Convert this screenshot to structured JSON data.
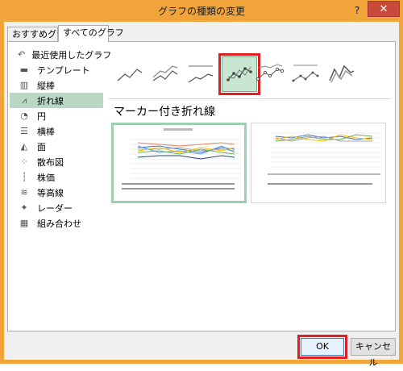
{
  "window": {
    "title": "グラフの種類の変更",
    "help_label": "?",
    "close_label": "✕"
  },
  "tabs": [
    {
      "label": "おすすめグラフ",
      "active": false
    },
    {
      "label": "すべてのグラフ",
      "active": true
    }
  ],
  "sidebar": {
    "items": [
      {
        "label": "最近使用したグラフ",
        "icon": "recent-icon",
        "glyph": "↶"
      },
      {
        "label": "テンプレート",
        "icon": "folder-icon",
        "glyph": "▬"
      },
      {
        "label": "縦棒",
        "icon": "column-chart-icon",
        "glyph": "▥"
      },
      {
        "label": "折れ線",
        "icon": "line-chart-icon",
        "glyph": "⩘",
        "selected": true
      },
      {
        "label": "円",
        "icon": "pie-chart-icon",
        "glyph": "◔"
      },
      {
        "label": "横棒",
        "icon": "bar-chart-icon",
        "glyph": "☰"
      },
      {
        "label": "面",
        "icon": "area-chart-icon",
        "glyph": "◭"
      },
      {
        "label": "散布図",
        "icon": "scatter-chart-icon",
        "glyph": "⁘"
      },
      {
        "label": "株価",
        "icon": "stock-chart-icon",
        "glyph": "┆"
      },
      {
        "label": "等高線",
        "icon": "surface-chart-icon",
        "glyph": "≋"
      },
      {
        "label": "レーダー",
        "icon": "radar-chart-icon",
        "glyph": "✦"
      },
      {
        "label": "組み合わせ",
        "icon": "combo-chart-icon",
        "glyph": "▦"
      }
    ]
  },
  "subtypes": {
    "selected_title": "マーカー付き折れ線",
    "icons": [
      "line-icon",
      "stacked-line-icon",
      "100-stacked-line-icon",
      "line-with-markers-icon",
      "stacked-line-with-markers-icon",
      "100-stacked-line-with-markers-icon",
      "3d-line-icon"
    ]
  },
  "colors": {
    "accent": "#f0a43a",
    "selected": "#b9d9c6",
    "highlight": "#e02020"
  },
  "buttons": {
    "ok": "OK",
    "cancel": "キャンセル"
  }
}
